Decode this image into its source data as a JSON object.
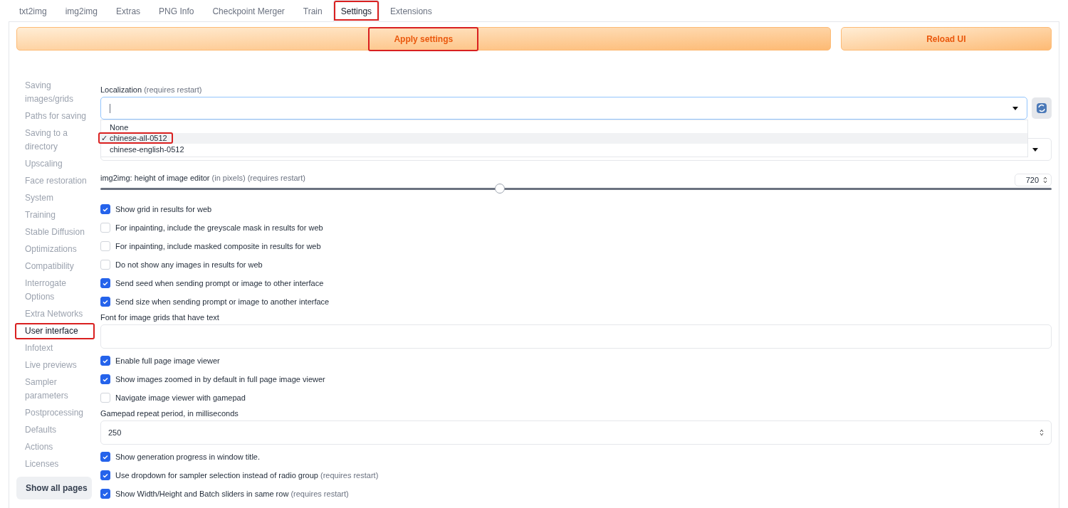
{
  "tabs": [
    {
      "label": "txt2img",
      "selected": false,
      "highlighted": false
    },
    {
      "label": "img2img",
      "selected": false,
      "highlighted": false
    },
    {
      "label": "Extras",
      "selected": false,
      "highlighted": false
    },
    {
      "label": "PNG Info",
      "selected": false,
      "highlighted": false
    },
    {
      "label": "Checkpoint Merger",
      "selected": false,
      "highlighted": false
    },
    {
      "label": "Train",
      "selected": false,
      "highlighted": false
    },
    {
      "label": "Settings",
      "selected": true,
      "highlighted": true
    },
    {
      "label": "Extensions",
      "selected": false,
      "highlighted": false
    }
  ],
  "actions": [
    {
      "label": "Apply settings",
      "highlighted": true
    },
    {
      "label": "Reload UI",
      "highlighted": false
    }
  ],
  "sidebar": {
    "items": [
      {
        "label": "Saving images/grids",
        "selected": false,
        "highlighted": false
      },
      {
        "label": "Paths for saving",
        "selected": false,
        "highlighted": false
      },
      {
        "label": "Saving to a directory",
        "selected": false,
        "highlighted": false
      },
      {
        "label": "Upscaling",
        "selected": false,
        "highlighted": false
      },
      {
        "label": "Face restoration",
        "selected": false,
        "highlighted": false
      },
      {
        "label": "System",
        "selected": false,
        "highlighted": false
      },
      {
        "label": "Training",
        "selected": false,
        "highlighted": false
      },
      {
        "label": "Stable Diffusion",
        "selected": false,
        "highlighted": false
      },
      {
        "label": "Optimizations",
        "selected": false,
        "highlighted": false
      },
      {
        "label": "Compatibility",
        "selected": false,
        "highlighted": false
      },
      {
        "label": "Interrogate Options",
        "selected": false,
        "highlighted": false
      },
      {
        "label": "Extra Networks",
        "selected": false,
        "highlighted": false
      },
      {
        "label": "User interface",
        "selected": true,
        "highlighted": true
      },
      {
        "label": "Infotext",
        "selected": false,
        "highlighted": false
      },
      {
        "label": "Live previews",
        "selected": false,
        "highlighted": false
      },
      {
        "label": "Sampler parameters",
        "selected": false,
        "highlighted": false
      },
      {
        "label": "Postprocessing",
        "selected": false,
        "highlighted": false
      },
      {
        "label": "Defaults",
        "selected": false,
        "highlighted": false
      },
      {
        "label": "Actions",
        "selected": false,
        "highlighted": false
      },
      {
        "label": "Licenses",
        "selected": false,
        "highlighted": false
      }
    ],
    "show_all": "Show all pages"
  },
  "settings": [
    {
      "kind": "select",
      "label": "Localization",
      "note": "(requires restart)",
      "check_mark": "✓",
      "options": [
        {
          "label": "None",
          "selected": false,
          "highlighted": false
        },
        {
          "label": "chinese-all-0512",
          "selected": true,
          "highlighted": true
        },
        {
          "label": "chinese-english-0512",
          "selected": false,
          "highlighted": false
        }
      ]
    },
    {
      "kind": "slider",
      "label": "img2img: height of image editor",
      "note": "(in pixels) (requires restart)",
      "value": "720",
      "level": 0.42
    },
    {
      "kind": "checkbox",
      "label": "Show grid in results for web",
      "checked": true
    },
    {
      "kind": "checkbox",
      "label": "For inpainting, include the greyscale mask in results for web",
      "checked": false
    },
    {
      "kind": "checkbox",
      "label": "For inpainting, include masked composite in results for web",
      "checked": false
    },
    {
      "kind": "checkbox",
      "label": "Do not show any images in results for web",
      "checked": false
    },
    {
      "kind": "checkbox",
      "label": "Send seed when sending prompt or image to other interface",
      "checked": true
    },
    {
      "kind": "checkbox",
      "label": "Send size when sending prompt or image to another interface",
      "checked": true
    },
    {
      "kind": "text",
      "label": "Font for image grids that have text"
    },
    {
      "kind": "checkbox",
      "label": "Enable full page image viewer",
      "checked": true
    },
    {
      "kind": "checkbox",
      "label": "Show images zoomed in by default in full page image viewer",
      "checked": true
    },
    {
      "kind": "checkbox",
      "label": "Navigate image viewer with gamepad",
      "checked": false
    },
    {
      "kind": "number",
      "label": "Gamepad repeat period, in milliseconds",
      "value": "250"
    },
    {
      "kind": "checkbox",
      "label": "Show generation progress in window title.",
      "checked": true
    },
    {
      "kind": "checkbox",
      "label": "Use dropdown for sampler selection instead of radio group",
      "note": "(requires restart)",
      "checked": true
    },
    {
      "kind": "checkbox",
      "label": "Show Width/Height and Batch sliders in same row",
      "note": "(requires restart)",
      "checked": true
    }
  ]
}
